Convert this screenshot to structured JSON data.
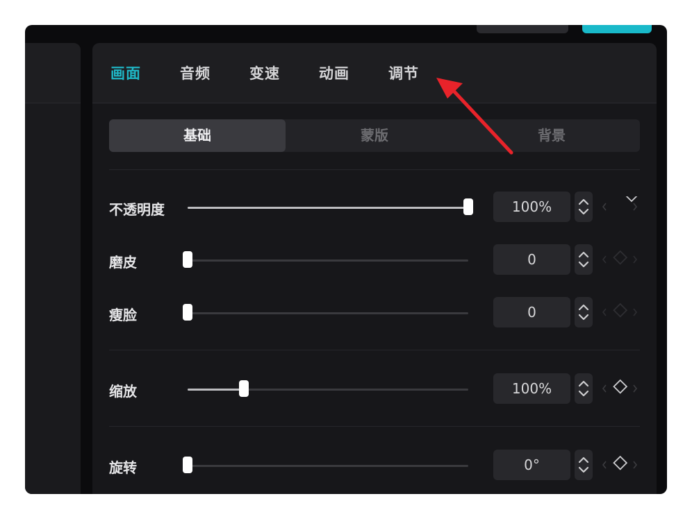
{
  "tabs": [
    {
      "label": "画面",
      "active": true
    },
    {
      "label": "音频",
      "active": false
    },
    {
      "label": "变速",
      "active": false
    },
    {
      "label": "动画",
      "active": false
    },
    {
      "label": "调节",
      "active": false
    }
  ],
  "segments": [
    {
      "label": "基础",
      "active": true
    },
    {
      "label": "蒙版",
      "active": false
    },
    {
      "label": "背景",
      "active": false
    }
  ],
  "rows": [
    {
      "label": "不透明度",
      "value": "100%",
      "level": 1.0
    },
    {
      "label": "磨皮",
      "value": "0",
      "level": 0
    },
    {
      "label": "瘦脸",
      "value": "0",
      "level": 0
    },
    {
      "label": "缩放",
      "value": "100%",
      "level": 0.2
    },
    {
      "label": "旋转",
      "value": "0°",
      "level": 0
    }
  ],
  "colors": {
    "accent": "#1fb7c6",
    "annotation_arrow": "#e8232a"
  }
}
